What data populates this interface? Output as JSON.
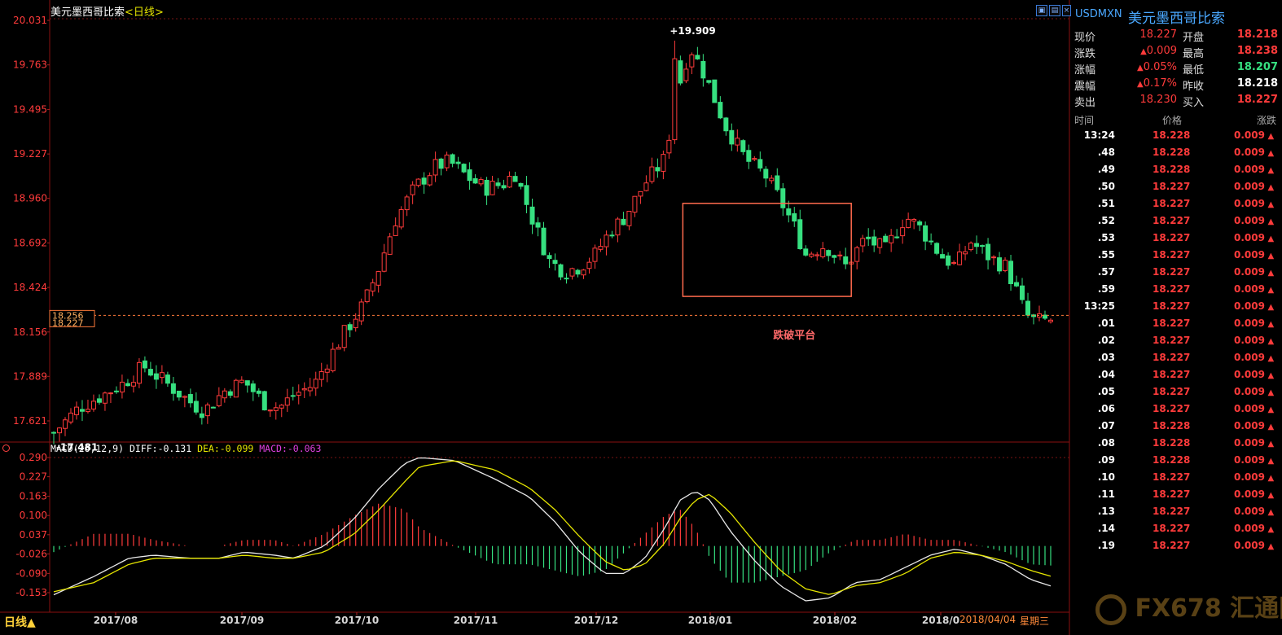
{
  "header": {
    "title": "美元墨西哥比索",
    "period_label": "日线"
  },
  "chart_data": [
    {
      "type": "candlestick",
      "title": "美元墨西哥比索",
      "period": "日线",
      "y_ticks": [
        "20.031",
        "19.763",
        "19.495",
        "19.227",
        "18.960",
        "18.692",
        "18.424",
        "18.156",
        "17.889",
        "17.621"
      ],
      "ylim": [
        17.4,
        20.09
      ],
      "x_labels": [
        "2017/08",
        "2017/09",
        "2017/10",
        "2017/11",
        "2017/12",
        "2018/01",
        "2018/02",
        "2018/0"
      ],
      "current_price_label": "18.256",
      "current_price_label_2": "18.227",
      "current_price_line": 18.256,
      "high_annotation": "+19.909",
      "high_value": 19.909,
      "low_annotation": "-17.481",
      "low_value": 17.481,
      "box_annotation": "跌破平台",
      "box_range": {
        "from_index": 126,
        "to_index": 159,
        "low": 18.37,
        "high": 18.93
      },
      "bar_count": 176,
      "path_keypoints": [
        [
          0,
          17.55
        ],
        [
          5,
          17.7
        ],
        [
          10,
          17.78
        ],
        [
          14,
          17.85
        ],
        [
          18,
          17.95
        ],
        [
          22,
          17.86
        ],
        [
          27,
          17.74
        ],
        [
          30,
          17.68
        ],
        [
          34,
          17.8
        ],
        [
          38,
          17.86
        ],
        [
          42,
          17.73
        ],
        [
          45,
          17.7
        ],
        [
          48,
          17.78
        ],
        [
          52,
          17.84
        ],
        [
          55,
          18.0
        ],
        [
          58,
          18.15
        ],
        [
          62,
          18.33
        ],
        [
          65,
          18.55
        ],
        [
          68,
          18.82
        ],
        [
          72,
          19.02
        ],
        [
          76,
          19.15
        ],
        [
          79,
          19.18
        ],
        [
          83,
          19.08
        ],
        [
          86,
          19.02
        ],
        [
          90,
          19.05
        ],
        [
          92,
          19.12
        ],
        [
          96,
          18.8
        ],
        [
          99,
          18.58
        ],
        [
          102,
          18.52
        ],
        [
          105,
          18.55
        ],
        [
          108,
          18.62
        ],
        [
          111,
          18.76
        ],
        [
          114,
          18.85
        ],
        [
          118,
          19.05
        ],
        [
          122,
          19.2
        ],
        [
          124,
          19.55
        ],
        [
          127,
          19.87
        ],
        [
          130,
          19.7
        ],
        [
          134,
          19.4
        ],
        [
          138,
          19.2
        ],
        [
          142,
          19.1
        ],
        [
          145,
          18.95
        ],
        [
          148,
          18.78
        ],
        [
          150,
          18.62
        ],
        [
          154,
          18.68
        ],
        [
          158,
          18.55
        ],
        [
          162,
          18.72
        ],
        [
          166,
          18.65
        ],
        [
          170,
          18.85
        ],
        [
          173,
          18.78
        ],
        [
          177,
          18.62
        ],
        [
          180,
          18.55
        ],
        [
          183,
          18.7
        ],
        [
          187,
          18.6
        ],
        [
          190,
          18.55
        ],
        [
          192,
          18.42
        ],
        [
          194,
          18.26
        ],
        [
          196,
          18.22
        ],
        [
          199,
          18.23
        ]
      ],
      "macd": {
        "label": "MACD(26,12,9)",
        "diff_label": "DIFF:-0.131",
        "dea_label": "DEA:-0.099",
        "macd_label": "MACD:-0.063",
        "y_ticks": [
          "0.290",
          "0.227",
          "0.163",
          "0.100",
          "0.037",
          "-0.026",
          "-0.090",
          "-0.153"
        ],
        "ylim": [
          -0.2,
          0.31
        ],
        "diff_keypoints": [
          [
            0,
            -0.16
          ],
          [
            8,
            -0.1
          ],
          [
            15,
            -0.04
          ],
          [
            20,
            -0.03
          ],
          [
            27,
            -0.04
          ],
          [
            33,
            -0.04
          ],
          [
            38,
            -0.02
          ],
          [
            44,
            -0.03
          ],
          [
            48,
            -0.04
          ],
          [
            54,
            0.0
          ],
          [
            60,
            0.09
          ],
          [
            65,
            0.19
          ],
          [
            70,
            0.27
          ],
          [
            73,
            0.29
          ],
          [
            80,
            0.28
          ],
          [
            88,
            0.22
          ],
          [
            95,
            0.16
          ],
          [
            100,
            0.08
          ],
          [
            105,
            -0.02
          ],
          [
            110,
            -0.09
          ],
          [
            114,
            -0.09
          ],
          [
            118,
            -0.04
          ],
          [
            122,
            0.06
          ],
          [
            125,
            0.15
          ],
          [
            128,
            0.18
          ],
          [
            131,
            0.15
          ],
          [
            135,
            0.05
          ],
          [
            140,
            -0.05
          ],
          [
            145,
            -0.13
          ],
          [
            150,
            -0.18
          ],
          [
            155,
            -0.17
          ],
          [
            160,
            -0.12
          ],
          [
            165,
            -0.11
          ],
          [
            170,
            -0.07
          ],
          [
            175,
            -0.03
          ],
          [
            180,
            -0.01
          ],
          [
            185,
            -0.03
          ],
          [
            190,
            -0.06
          ],
          [
            195,
            -0.11
          ],
          [
            199,
            -0.131
          ]
        ],
        "dea_keypoints": [
          [
            0,
            -0.15
          ],
          [
            8,
            -0.12
          ],
          [
            15,
            -0.06
          ],
          [
            20,
            -0.04
          ],
          [
            27,
            -0.04
          ],
          [
            33,
            -0.04
          ],
          [
            38,
            -0.03
          ],
          [
            44,
            -0.04
          ],
          [
            48,
            -0.04
          ],
          [
            54,
            -0.02
          ],
          [
            60,
            0.04
          ],
          [
            65,
            0.12
          ],
          [
            70,
            0.21
          ],
          [
            73,
            0.26
          ],
          [
            80,
            0.28
          ],
          [
            88,
            0.25
          ],
          [
            95,
            0.19
          ],
          [
            100,
            0.12
          ],
          [
            105,
            0.03
          ],
          [
            110,
            -0.05
          ],
          [
            114,
            -0.08
          ],
          [
            118,
            -0.06
          ],
          [
            122,
            0.01
          ],
          [
            125,
            0.09
          ],
          [
            128,
            0.15
          ],
          [
            131,
            0.17
          ],
          [
            135,
            0.11
          ],
          [
            140,
            0.01
          ],
          [
            145,
            -0.08
          ],
          [
            150,
            -0.14
          ],
          [
            155,
            -0.16
          ],
          [
            160,
            -0.13
          ],
          [
            165,
            -0.12
          ],
          [
            170,
            -0.09
          ],
          [
            175,
            -0.04
          ],
          [
            180,
            -0.02
          ],
          [
            185,
            -0.03
          ],
          [
            190,
            -0.05
          ],
          [
            195,
            -0.08
          ],
          [
            199,
            -0.099
          ]
        ]
      }
    }
  ],
  "quote": {
    "symbol": "USDMXN",
    "name": "美元墨西哥比索",
    "rows": [
      {
        "label1": "现价",
        "value1": "18.227",
        "label2": "开盘",
        "value2": "18.218",
        "arrow1": ""
      },
      {
        "label1": "涨跌",
        "value1": "0.009",
        "label2": "最高",
        "value2": "18.238",
        "arrow1": "▲"
      },
      {
        "label1": "涨幅",
        "value1": "0.05%",
        "label2": "最低",
        "value2": "18.207",
        "arrow1": "▲"
      },
      {
        "label1": "震幅",
        "value1": "0.17%",
        "label2": "昨收",
        "value2": "18.218",
        "arrow1": "▲"
      },
      {
        "label1": "卖出",
        "value1": "18.230",
        "label2": "买入",
        "value2": "18.227",
        "arrow1": ""
      }
    ],
    "ticks_header": {
      "time": "时间",
      "price": "价格",
      "change": "涨跌"
    },
    "ticks": [
      {
        "time": "13:24",
        "price": "18.228",
        "change": "0.009"
      },
      {
        "time": ".48",
        "price": "18.228",
        "change": "0.009"
      },
      {
        "time": ".49",
        "price": "18.228",
        "change": "0.009"
      },
      {
        "time": ".50",
        "price": "18.227",
        "change": "0.009"
      },
      {
        "time": ".51",
        "price": "18.227",
        "change": "0.009"
      },
      {
        "time": ".52",
        "price": "18.227",
        "change": "0.009"
      },
      {
        "time": ".53",
        "price": "18.227",
        "change": "0.009"
      },
      {
        "time": ".55",
        "price": "18.227",
        "change": "0.009"
      },
      {
        "time": ".57",
        "price": "18.227",
        "change": "0.009"
      },
      {
        "time": ".59",
        "price": "18.227",
        "change": "0.009"
      },
      {
        "time": "13:25",
        "price": "18.227",
        "change": "0.009"
      },
      {
        "time": ".01",
        "price": "18.227",
        "change": "0.009"
      },
      {
        "time": ".02",
        "price": "18.227",
        "change": "0.009"
      },
      {
        "time": ".03",
        "price": "18.227",
        "change": "0.009"
      },
      {
        "time": ".04",
        "price": "18.227",
        "change": "0.009"
      },
      {
        "time": ".05",
        "price": "18.227",
        "change": "0.009"
      },
      {
        "time": ".06",
        "price": "18.227",
        "change": "0.009"
      },
      {
        "time": ".07",
        "price": "18.228",
        "change": "0.009"
      },
      {
        "time": ".08",
        "price": "18.228",
        "change": "0.009"
      },
      {
        "time": ".09",
        "price": "18.228",
        "change": "0.009"
      },
      {
        "time": ".10",
        "price": "18.227",
        "change": "0.009"
      },
      {
        "time": ".11",
        "price": "18.227",
        "change": "0.009"
      },
      {
        "time": ".13",
        "price": "18.227",
        "change": "0.009"
      },
      {
        "time": ".14",
        "price": "18.227",
        "change": "0.009"
      },
      {
        "time": ".19",
        "price": "18.227",
        "change": "0.009"
      }
    ]
  },
  "footer": {
    "period_tab": "日线▲",
    "date_text": "2018/04/04",
    "weekday_text": "星期三",
    "watermark": "FX678 汇通网"
  },
  "colors": {
    "up": "#ff3b3b",
    "down": "#36e080",
    "box": "#ff6a4d",
    "dea": "#e6e600",
    "diff": "#e8e8e8",
    "price_line": "#ff7a3a"
  }
}
